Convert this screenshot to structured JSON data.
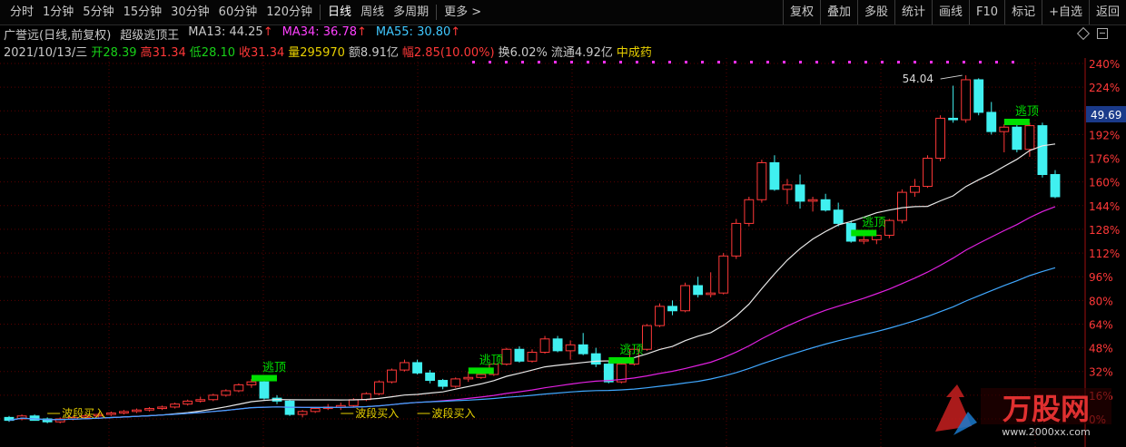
{
  "toolbar": {
    "periods": [
      "分时",
      "1分钟",
      "5分钟",
      "15分钟",
      "30分钟",
      "60分钟",
      "120分钟",
      "日线",
      "周线",
      "多周期",
      "更多 >"
    ],
    "active_period": "日线",
    "buttons": [
      "复权",
      "叠加",
      "多股",
      "统计",
      "画线",
      "F10",
      "标记",
      "+自选",
      "返回"
    ]
  },
  "header": {
    "stock_name": "广誉远(日线,前复权)",
    "indicator_name": "超级逃顶王",
    "ma13_label": "MA13:",
    "ma13_value": "44.25",
    "ma34_label": "MA34:",
    "ma34_value": "36.78",
    "ma55_label": "MA55:",
    "ma55_value": "30.80",
    "up_arrow": "↑"
  },
  "quote": {
    "date": "2021/10/13/三",
    "open_label": "开",
    "open": "28.39",
    "high_label": "高",
    "high": "31.34",
    "low_label": "低",
    "low": "28.10",
    "close_label": "收",
    "close": "31.34",
    "volume_label": "量",
    "volume": "295970",
    "amount_label": "额",
    "amount": "8.91亿",
    "change_label": "幅",
    "change": "2.85(10.00%)",
    "turnover_label": "换",
    "turnover": "6.02%",
    "float_label": "流通",
    "float": "4.92亿",
    "sector": "中成药"
  },
  "colors": {
    "up": "#ff3838",
    "down": "#40f0f0",
    "ma13": "#e8e8e8",
    "ma34": "#e020e0",
    "ma55": "#40a8ff",
    "signal": "#00e000",
    "grid": "#5a0000",
    "axis_text": "#ff3838"
  },
  "price_axis": [
    "240%",
    "224%",
    "208%",
    "192%",
    "176%",
    "160%",
    "144%",
    "128%",
    "112%",
    "96%",
    "80%",
    "64%",
    "48%",
    "32%",
    "16%",
    "0%"
  ],
  "current_price_tag": "49.69",
  "annotations": {
    "peak_label": "54.04",
    "escape_signal": "逃顶",
    "buy_signal": "波段买入"
  },
  "watermark": {
    "brand": "万股网",
    "url": "www.2000xx.com"
  },
  "chart_data": {
    "type": "candlestick",
    "title": "",
    "y_axis_unit": "%",
    "ylim": [
      0,
      240
    ],
    "signals": [
      {
        "type": "逃顶",
        "index": 20
      },
      {
        "type": "逃顶",
        "index": 37
      },
      {
        "type": "逃顶",
        "index": 48
      },
      {
        "type": "逃顶",
        "index": 67
      },
      {
        "type": "逃顶",
        "index": 79
      },
      {
        "type": "波段买入",
        "index": 3
      },
      {
        "type": "波段买入",
        "index": 26
      },
      {
        "type": "波段买入",
        "index": 32
      }
    ],
    "candles": [
      {
        "o": 1,
        "h": 2,
        "l": -2,
        "c": -1
      },
      {
        "o": 0,
        "h": 3,
        "l": -1,
        "c": 2
      },
      {
        "o": 2,
        "h": 3,
        "l": -1,
        "c": -1
      },
      {
        "o": 0,
        "h": 1,
        "l": -3,
        "c": -2
      },
      {
        "o": -2,
        "h": 1,
        "l": -3,
        "c": 0
      },
      {
        "o": 0,
        "h": 2,
        "l": -1,
        "c": 1
      },
      {
        "o": 1,
        "h": 3,
        "l": 0,
        "c": 2
      },
      {
        "o": 2,
        "h": 4,
        "l": 1,
        "c": 3
      },
      {
        "o": 3,
        "h": 5,
        "l": 2,
        "c": 4
      },
      {
        "o": 4,
        "h": 6,
        "l": 3,
        "c": 5
      },
      {
        "o": 5,
        "h": 7,
        "l": 4,
        "c": 6
      },
      {
        "o": 6,
        "h": 8,
        "l": 5,
        "c": 7
      },
      {
        "o": 7,
        "h": 9,
        "l": 6,
        "c": 8
      },
      {
        "o": 8,
        "h": 11,
        "l": 7,
        "c": 10
      },
      {
        "o": 10,
        "h": 13,
        "l": 9,
        "c": 12
      },
      {
        "o": 12,
        "h": 15,
        "l": 11,
        "c": 13
      },
      {
        "o": 13,
        "h": 17,
        "l": 12,
        "c": 16
      },
      {
        "o": 16,
        "h": 20,
        "l": 15,
        "c": 19
      },
      {
        "o": 19,
        "h": 24,
        "l": 18,
        "c": 23
      },
      {
        "o": 23,
        "h": 27,
        "l": 21,
        "c": 25
      },
      {
        "o": 25,
        "h": 26,
        "l": 13,
        "c": 14
      },
      {
        "o": 14,
        "h": 16,
        "l": 10,
        "c": 12
      },
      {
        "o": 12,
        "h": 13,
        "l": 2,
        "c": 3
      },
      {
        "o": 3,
        "h": 6,
        "l": 1,
        "c": 5
      },
      {
        "o": 5,
        "h": 8,
        "l": 4,
        "c": 7
      },
      {
        "o": 7,
        "h": 10,
        "l": 6,
        "c": 8
      },
      {
        "o": 8,
        "h": 11,
        "l": 6,
        "c": 9
      },
      {
        "o": 9,
        "h": 14,
        "l": 8,
        "c": 13
      },
      {
        "o": 13,
        "h": 18,
        "l": 12,
        "c": 17
      },
      {
        "o": 17,
        "h": 26,
        "l": 16,
        "c": 25
      },
      {
        "o": 25,
        "h": 34,
        "l": 24,
        "c": 33
      },
      {
        "o": 33,
        "h": 40,
        "l": 32,
        "c": 38
      },
      {
        "o": 38,
        "h": 40,
        "l": 30,
        "c": 31
      },
      {
        "o": 31,
        "h": 33,
        "l": 24,
        "c": 26
      },
      {
        "o": 26,
        "h": 27,
        "l": 20,
        "c": 22
      },
      {
        "o": 22,
        "h": 28,
        "l": 21,
        "c": 27
      },
      {
        "o": 27,
        "h": 32,
        "l": 25,
        "c": 28
      },
      {
        "o": 28,
        "h": 31,
        "l": 27,
        "c": 30
      },
      {
        "o": 30,
        "h": 38,
        "l": 29,
        "c": 37
      },
      {
        "o": 37,
        "h": 48,
        "l": 36,
        "c": 47
      },
      {
        "o": 47,
        "h": 49,
        "l": 38,
        "c": 39
      },
      {
        "o": 39,
        "h": 47,
        "l": 38,
        "c": 45
      },
      {
        "o": 45,
        "h": 56,
        "l": 44,
        "c": 54
      },
      {
        "o": 54,
        "h": 56,
        "l": 45,
        "c": 46
      },
      {
        "o": 46,
        "h": 53,
        "l": 40,
        "c": 50
      },
      {
        "o": 50,
        "h": 58,
        "l": 43,
        "c": 44
      },
      {
        "o": 44,
        "h": 48,
        "l": 35,
        "c": 37
      },
      {
        "o": 37,
        "h": 39,
        "l": 24,
        "c": 25
      },
      {
        "o": 25,
        "h": 38,
        "l": 24,
        "c": 37
      },
      {
        "o": 37,
        "h": 48,
        "l": 36,
        "c": 47
      },
      {
        "o": 47,
        "h": 64,
        "l": 46,
        "c": 63
      },
      {
        "o": 63,
        "h": 78,
        "l": 62,
        "c": 76
      },
      {
        "o": 76,
        "h": 80,
        "l": 70,
        "c": 73
      },
      {
        "o": 73,
        "h": 92,
        "l": 72,
        "c": 90
      },
      {
        "o": 90,
        "h": 96,
        "l": 82,
        "c": 84
      },
      {
        "o": 84,
        "h": 99,
        "l": 82,
        "c": 85
      },
      {
        "o": 85,
        "h": 112,
        "l": 84,
        "c": 110
      },
      {
        "o": 110,
        "h": 135,
        "l": 108,
        "c": 132
      },
      {
        "o": 132,
        "h": 150,
        "l": 130,
        "c": 148
      },
      {
        "o": 148,
        "h": 175,
        "l": 146,
        "c": 173
      },
      {
        "o": 173,
        "h": 178,
        "l": 154,
        "c": 155
      },
      {
        "o": 155,
        "h": 162,
        "l": 145,
        "c": 158
      },
      {
        "o": 158,
        "h": 165,
        "l": 142,
        "c": 147
      },
      {
        "o": 147,
        "h": 150,
        "l": 140,
        "c": 148
      },
      {
        "o": 148,
        "h": 152,
        "l": 140,
        "c": 141
      },
      {
        "o": 141,
        "h": 146,
        "l": 130,
        "c": 132
      },
      {
        "o": 132,
        "h": 134,
        "l": 119,
        "c": 120
      },
      {
        "o": 120,
        "h": 124,
        "l": 118,
        "c": 121
      },
      {
        "o": 121,
        "h": 124,
        "l": 118,
        "c": 124
      },
      {
        "o": 124,
        "h": 135,
        "l": 122,
        "c": 134
      },
      {
        "o": 134,
        "h": 155,
        "l": 132,
        "c": 153
      },
      {
        "o": 153,
        "h": 162,
        "l": 150,
        "c": 157
      },
      {
        "o": 157,
        "h": 178,
        "l": 156,
        "c": 176
      },
      {
        "o": 176,
        "h": 205,
        "l": 174,
        "c": 203
      },
      {
        "o": 203,
        "h": 225,
        "l": 200,
        "c": 202
      },
      {
        "o": 202,
        "h": 232,
        "l": 200,
        "c": 229
      },
      {
        "o": 229,
        "h": 230,
        "l": 205,
        "c": 207
      },
      {
        "o": 207,
        "h": 214,
        "l": 192,
        "c": 194
      },
      {
        "o": 194,
        "h": 199,
        "l": 180,
        "c": 197
      },
      {
        "o": 197,
        "h": 199,
        "l": 180,
        "c": 182
      },
      {
        "o": 182,
        "h": 200,
        "l": 177,
        "c": 198
      },
      {
        "o": 198,
        "h": 200,
        "l": 163,
        "c": 165
      },
      {
        "o": 165,
        "h": 168,
        "l": 149,
        "c": 150
      }
    ]
  }
}
